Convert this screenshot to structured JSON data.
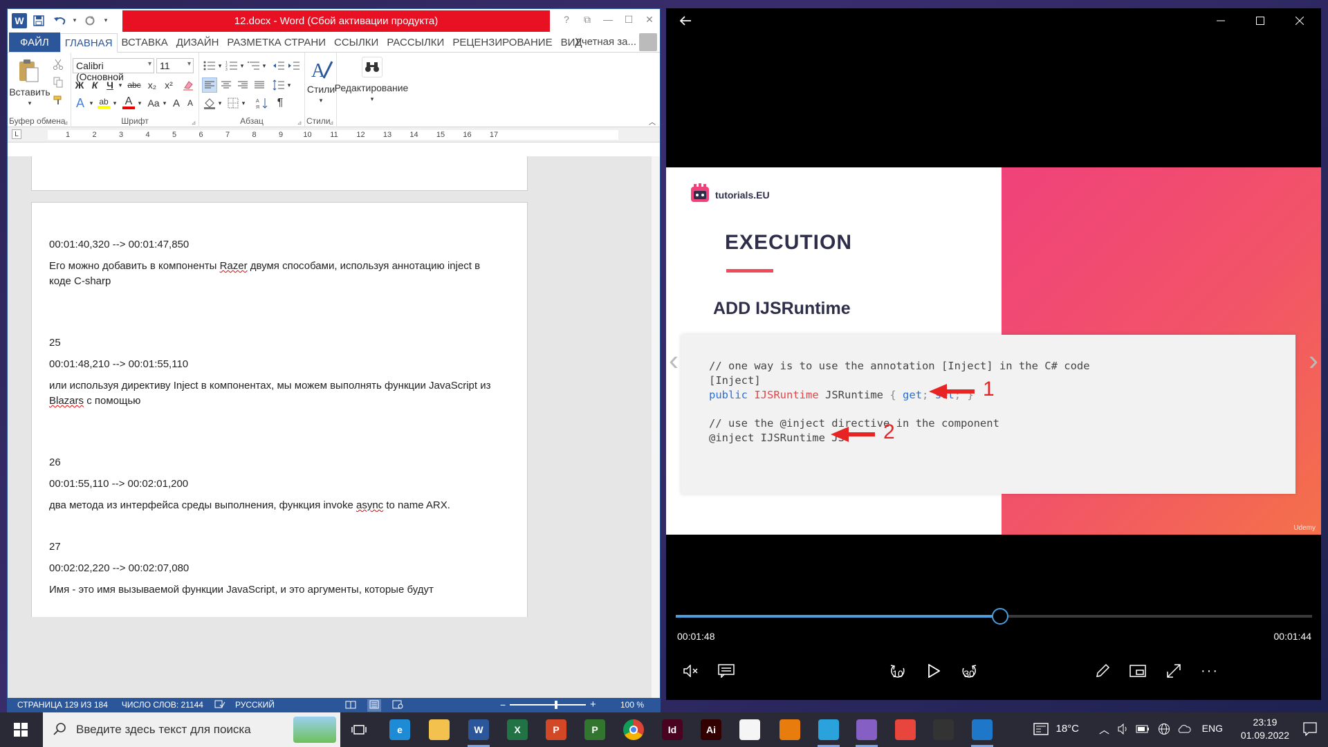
{
  "word": {
    "title": "12.docx -  Word (Сбой активации продукта)",
    "qat": {
      "logo": "W",
      "save_icon": "save-icon",
      "undo_icon": "undo-icon",
      "redo_icon": "redo-icon"
    },
    "window_controls": {
      "help": "?",
      "ribbon_display": "⧉",
      "minimize": "—",
      "maximize": "☐",
      "close": "✕"
    },
    "tabs": [
      "ФАЙЛ",
      "ГЛАВНАЯ",
      "ВСТАВКА",
      "ДИЗАЙН",
      "РАЗМЕТКА СТРАНИ",
      "ССЫЛКИ",
      "РАССЫЛКИ",
      "РЕЦЕНЗИРОВАНИЕ",
      "ВИД"
    ],
    "active_tab": "ГЛАВНАЯ",
    "account": "Учетная за...",
    "ribbon": {
      "clipboard": {
        "paste": "Вставить",
        "group": "Буфер обмена"
      },
      "font": {
        "name": "Calibri (Основной",
        "size": "11",
        "group": "Шрифт",
        "bold": "Ж",
        "italic": "К",
        "underline": "Ч",
        "strike": "abc",
        "sub": "x₂",
        "sup": "x²",
        "case": "Aa",
        "grow": "A",
        "shrink": "A"
      },
      "paragraph": {
        "group": "Абзац",
        "pilcrow": "¶"
      },
      "styles": {
        "label": "Стили",
        "group": "Стили"
      },
      "editing": {
        "label": "Редактирование"
      }
    },
    "ruler": {
      "marks": [
        "1",
        "2",
        "3",
        "4",
        "5",
        "6",
        "7",
        "8",
        "9",
        "10",
        "11",
        "12",
        "13",
        "14",
        "15",
        "16",
        "17"
      ],
      "tab_marker": "L"
    },
    "document": {
      "paragraphs": [
        {
          "text": "00:01:40,320 --> 00:01:47,850"
        },
        {
          "pre": "Его можно добавить в компоненты ",
          "err": "Razer",
          "post": " двумя способами, используя аннотацию inject в коде C-sharp"
        },
        {
          "text": "25"
        },
        {
          "text": "00:01:48,210 --> 00:01:55,110"
        },
        {
          "pre": "или используя директиву Inject в компонентах, мы можем выполнять функции JavaScript из ",
          "err": "Blazars",
          "post": " с помощью"
        },
        {
          "text": "26"
        },
        {
          "text": "00:01:55,110 --> 00:02:01,200"
        },
        {
          "pre": "два метода из интерфейса среды выполнения, функция invoke ",
          "err": "async",
          "post": " to name ARX."
        },
        {
          "text": "27"
        },
        {
          "text": "00:02:02,220 --> 00:02:07,080"
        },
        {
          "text": "Имя - это имя вызываемой функции JavaScript, и это аргументы, которые будут"
        }
      ]
    },
    "status": {
      "page": "СТРАНИЦА 129 ИЗ 184",
      "words": "ЧИСЛО СЛОВ: 21144",
      "lang": "РУССКИЙ",
      "zoom_minus": "−",
      "zoom_plus": "+",
      "zoom": "100 %"
    }
  },
  "player": {
    "back_icon": "back-arrow-icon",
    "slide": {
      "logo": "tutorials.EU",
      "heading": "EXECUTION",
      "subheading": "ADD IJSRuntime",
      "code": {
        "comment1": "// one way is to use the annotation [Inject] in the C# code",
        "attr": "[Inject]",
        "kw_public": "public",
        "type": "IJSRuntime",
        "name": "JSRuntime",
        "brace_open": "{",
        "kw_get": "get",
        "semi1": ";",
        "kw_set": "set",
        "semi2": ";",
        "brace_close": "}",
        "comment2": "// use the @inject directive in the component",
        "directive": "@inject IJSRuntime JS",
        "marker1": "1",
        "marker2": "2"
      },
      "watermark": "Udemy"
    },
    "progress": 0.51,
    "time_current": "00:01:48",
    "time_remaining": "00:01:44",
    "controls": {
      "rewind": "10",
      "forward": "30"
    }
  },
  "taskbar": {
    "search_placeholder": "Введите здесь текст для поиска",
    "apps": [
      {
        "name": "task-view",
        "label": ""
      },
      {
        "name": "edge",
        "label": "e",
        "color": "#1e8bd6"
      },
      {
        "name": "explorer",
        "label": "",
        "color": "#f2c14e"
      },
      {
        "name": "word",
        "label": "W",
        "color": "#2b579a"
      },
      {
        "name": "excel",
        "label": "X",
        "color": "#217346"
      },
      {
        "name": "powerpoint",
        "label": "P",
        "color": "#d24726"
      },
      {
        "name": "project",
        "label": "P",
        "color": "#31752f"
      },
      {
        "name": "chrome",
        "label": "",
        "color": "#e44134"
      },
      {
        "name": "indesign",
        "label": "Id",
        "color": "#49021f"
      },
      {
        "name": "illustrator",
        "label": "Ai",
        "color": "#330000"
      },
      {
        "name": "notepad",
        "label": "",
        "color": "#f5f5f5"
      },
      {
        "name": "blender",
        "label": "",
        "color": "#e87d0d"
      },
      {
        "name": "telegram",
        "label": "",
        "color": "#2aa3dc"
      },
      {
        "name": "visual-studio",
        "label": "",
        "color": "#865fc5"
      },
      {
        "name": "git",
        "label": "",
        "color": "#e8453c"
      },
      {
        "name": "terminal",
        "label": "",
        "color": "#333"
      },
      {
        "name": "movies-tv",
        "label": "",
        "color": "#1f77c9"
      }
    ],
    "tray": {
      "temp": "18°C",
      "lang": "ENG",
      "time": "23:19",
      "date": "01.09.2022"
    }
  }
}
